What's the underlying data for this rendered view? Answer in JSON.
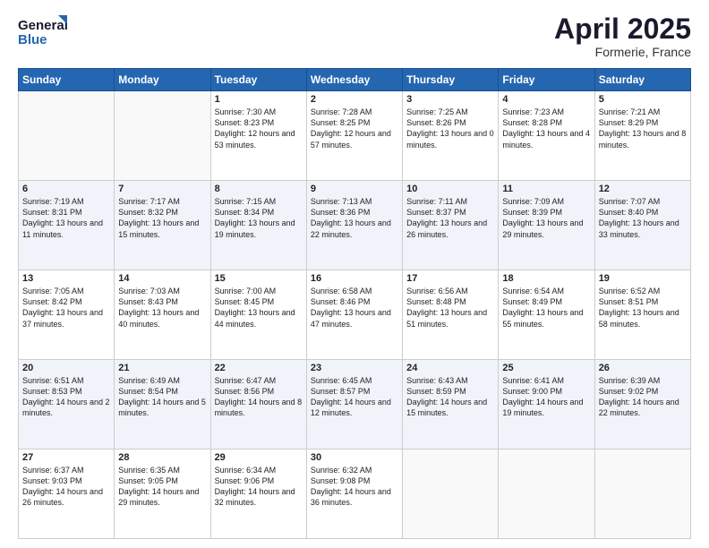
{
  "logo": {
    "line1": "General",
    "line2": "Blue"
  },
  "title": "April 2025",
  "subtitle": "Formerie, France",
  "days_of_week": [
    "Sunday",
    "Monday",
    "Tuesday",
    "Wednesday",
    "Thursday",
    "Friday",
    "Saturday"
  ],
  "weeks": [
    [
      {
        "day": "",
        "sunrise": "",
        "sunset": "",
        "daylight": ""
      },
      {
        "day": "",
        "sunrise": "",
        "sunset": "",
        "daylight": ""
      },
      {
        "day": "1",
        "sunrise": "Sunrise: 7:30 AM",
        "sunset": "Sunset: 8:23 PM",
        "daylight": "Daylight: 12 hours and 53 minutes."
      },
      {
        "day": "2",
        "sunrise": "Sunrise: 7:28 AM",
        "sunset": "Sunset: 8:25 PM",
        "daylight": "Daylight: 12 hours and 57 minutes."
      },
      {
        "day": "3",
        "sunrise": "Sunrise: 7:25 AM",
        "sunset": "Sunset: 8:26 PM",
        "daylight": "Daylight: 13 hours and 0 minutes."
      },
      {
        "day": "4",
        "sunrise": "Sunrise: 7:23 AM",
        "sunset": "Sunset: 8:28 PM",
        "daylight": "Daylight: 13 hours and 4 minutes."
      },
      {
        "day": "5",
        "sunrise": "Sunrise: 7:21 AM",
        "sunset": "Sunset: 8:29 PM",
        "daylight": "Daylight: 13 hours and 8 minutes."
      }
    ],
    [
      {
        "day": "6",
        "sunrise": "Sunrise: 7:19 AM",
        "sunset": "Sunset: 8:31 PM",
        "daylight": "Daylight: 13 hours and 11 minutes."
      },
      {
        "day": "7",
        "sunrise": "Sunrise: 7:17 AM",
        "sunset": "Sunset: 8:32 PM",
        "daylight": "Daylight: 13 hours and 15 minutes."
      },
      {
        "day": "8",
        "sunrise": "Sunrise: 7:15 AM",
        "sunset": "Sunset: 8:34 PM",
        "daylight": "Daylight: 13 hours and 19 minutes."
      },
      {
        "day": "9",
        "sunrise": "Sunrise: 7:13 AM",
        "sunset": "Sunset: 8:36 PM",
        "daylight": "Daylight: 13 hours and 22 minutes."
      },
      {
        "day": "10",
        "sunrise": "Sunrise: 7:11 AM",
        "sunset": "Sunset: 8:37 PM",
        "daylight": "Daylight: 13 hours and 26 minutes."
      },
      {
        "day": "11",
        "sunrise": "Sunrise: 7:09 AM",
        "sunset": "Sunset: 8:39 PM",
        "daylight": "Daylight: 13 hours and 29 minutes."
      },
      {
        "day": "12",
        "sunrise": "Sunrise: 7:07 AM",
        "sunset": "Sunset: 8:40 PM",
        "daylight": "Daylight: 13 hours and 33 minutes."
      }
    ],
    [
      {
        "day": "13",
        "sunrise": "Sunrise: 7:05 AM",
        "sunset": "Sunset: 8:42 PM",
        "daylight": "Daylight: 13 hours and 37 minutes."
      },
      {
        "day": "14",
        "sunrise": "Sunrise: 7:03 AM",
        "sunset": "Sunset: 8:43 PM",
        "daylight": "Daylight: 13 hours and 40 minutes."
      },
      {
        "day": "15",
        "sunrise": "Sunrise: 7:00 AM",
        "sunset": "Sunset: 8:45 PM",
        "daylight": "Daylight: 13 hours and 44 minutes."
      },
      {
        "day": "16",
        "sunrise": "Sunrise: 6:58 AM",
        "sunset": "Sunset: 8:46 PM",
        "daylight": "Daylight: 13 hours and 47 minutes."
      },
      {
        "day": "17",
        "sunrise": "Sunrise: 6:56 AM",
        "sunset": "Sunset: 8:48 PM",
        "daylight": "Daylight: 13 hours and 51 minutes."
      },
      {
        "day": "18",
        "sunrise": "Sunrise: 6:54 AM",
        "sunset": "Sunset: 8:49 PM",
        "daylight": "Daylight: 13 hours and 55 minutes."
      },
      {
        "day": "19",
        "sunrise": "Sunrise: 6:52 AM",
        "sunset": "Sunset: 8:51 PM",
        "daylight": "Daylight: 13 hours and 58 minutes."
      }
    ],
    [
      {
        "day": "20",
        "sunrise": "Sunrise: 6:51 AM",
        "sunset": "Sunset: 8:53 PM",
        "daylight": "Daylight: 14 hours and 2 minutes."
      },
      {
        "day": "21",
        "sunrise": "Sunrise: 6:49 AM",
        "sunset": "Sunset: 8:54 PM",
        "daylight": "Daylight: 14 hours and 5 minutes."
      },
      {
        "day": "22",
        "sunrise": "Sunrise: 6:47 AM",
        "sunset": "Sunset: 8:56 PM",
        "daylight": "Daylight: 14 hours and 8 minutes."
      },
      {
        "day": "23",
        "sunrise": "Sunrise: 6:45 AM",
        "sunset": "Sunset: 8:57 PM",
        "daylight": "Daylight: 14 hours and 12 minutes."
      },
      {
        "day": "24",
        "sunrise": "Sunrise: 6:43 AM",
        "sunset": "Sunset: 8:59 PM",
        "daylight": "Daylight: 14 hours and 15 minutes."
      },
      {
        "day": "25",
        "sunrise": "Sunrise: 6:41 AM",
        "sunset": "Sunset: 9:00 PM",
        "daylight": "Daylight: 14 hours and 19 minutes."
      },
      {
        "day": "26",
        "sunrise": "Sunrise: 6:39 AM",
        "sunset": "Sunset: 9:02 PM",
        "daylight": "Daylight: 14 hours and 22 minutes."
      }
    ],
    [
      {
        "day": "27",
        "sunrise": "Sunrise: 6:37 AM",
        "sunset": "Sunset: 9:03 PM",
        "daylight": "Daylight: 14 hours and 26 minutes."
      },
      {
        "day": "28",
        "sunrise": "Sunrise: 6:35 AM",
        "sunset": "Sunset: 9:05 PM",
        "daylight": "Daylight: 14 hours and 29 minutes."
      },
      {
        "day": "29",
        "sunrise": "Sunrise: 6:34 AM",
        "sunset": "Sunset: 9:06 PM",
        "daylight": "Daylight: 14 hours and 32 minutes."
      },
      {
        "day": "30",
        "sunrise": "Sunrise: 6:32 AM",
        "sunset": "Sunset: 9:08 PM",
        "daylight": "Daylight: 14 hours and 36 minutes."
      },
      {
        "day": "",
        "sunrise": "",
        "sunset": "",
        "daylight": ""
      },
      {
        "day": "",
        "sunrise": "",
        "sunset": "",
        "daylight": ""
      },
      {
        "day": "",
        "sunrise": "",
        "sunset": "",
        "daylight": ""
      }
    ]
  ]
}
